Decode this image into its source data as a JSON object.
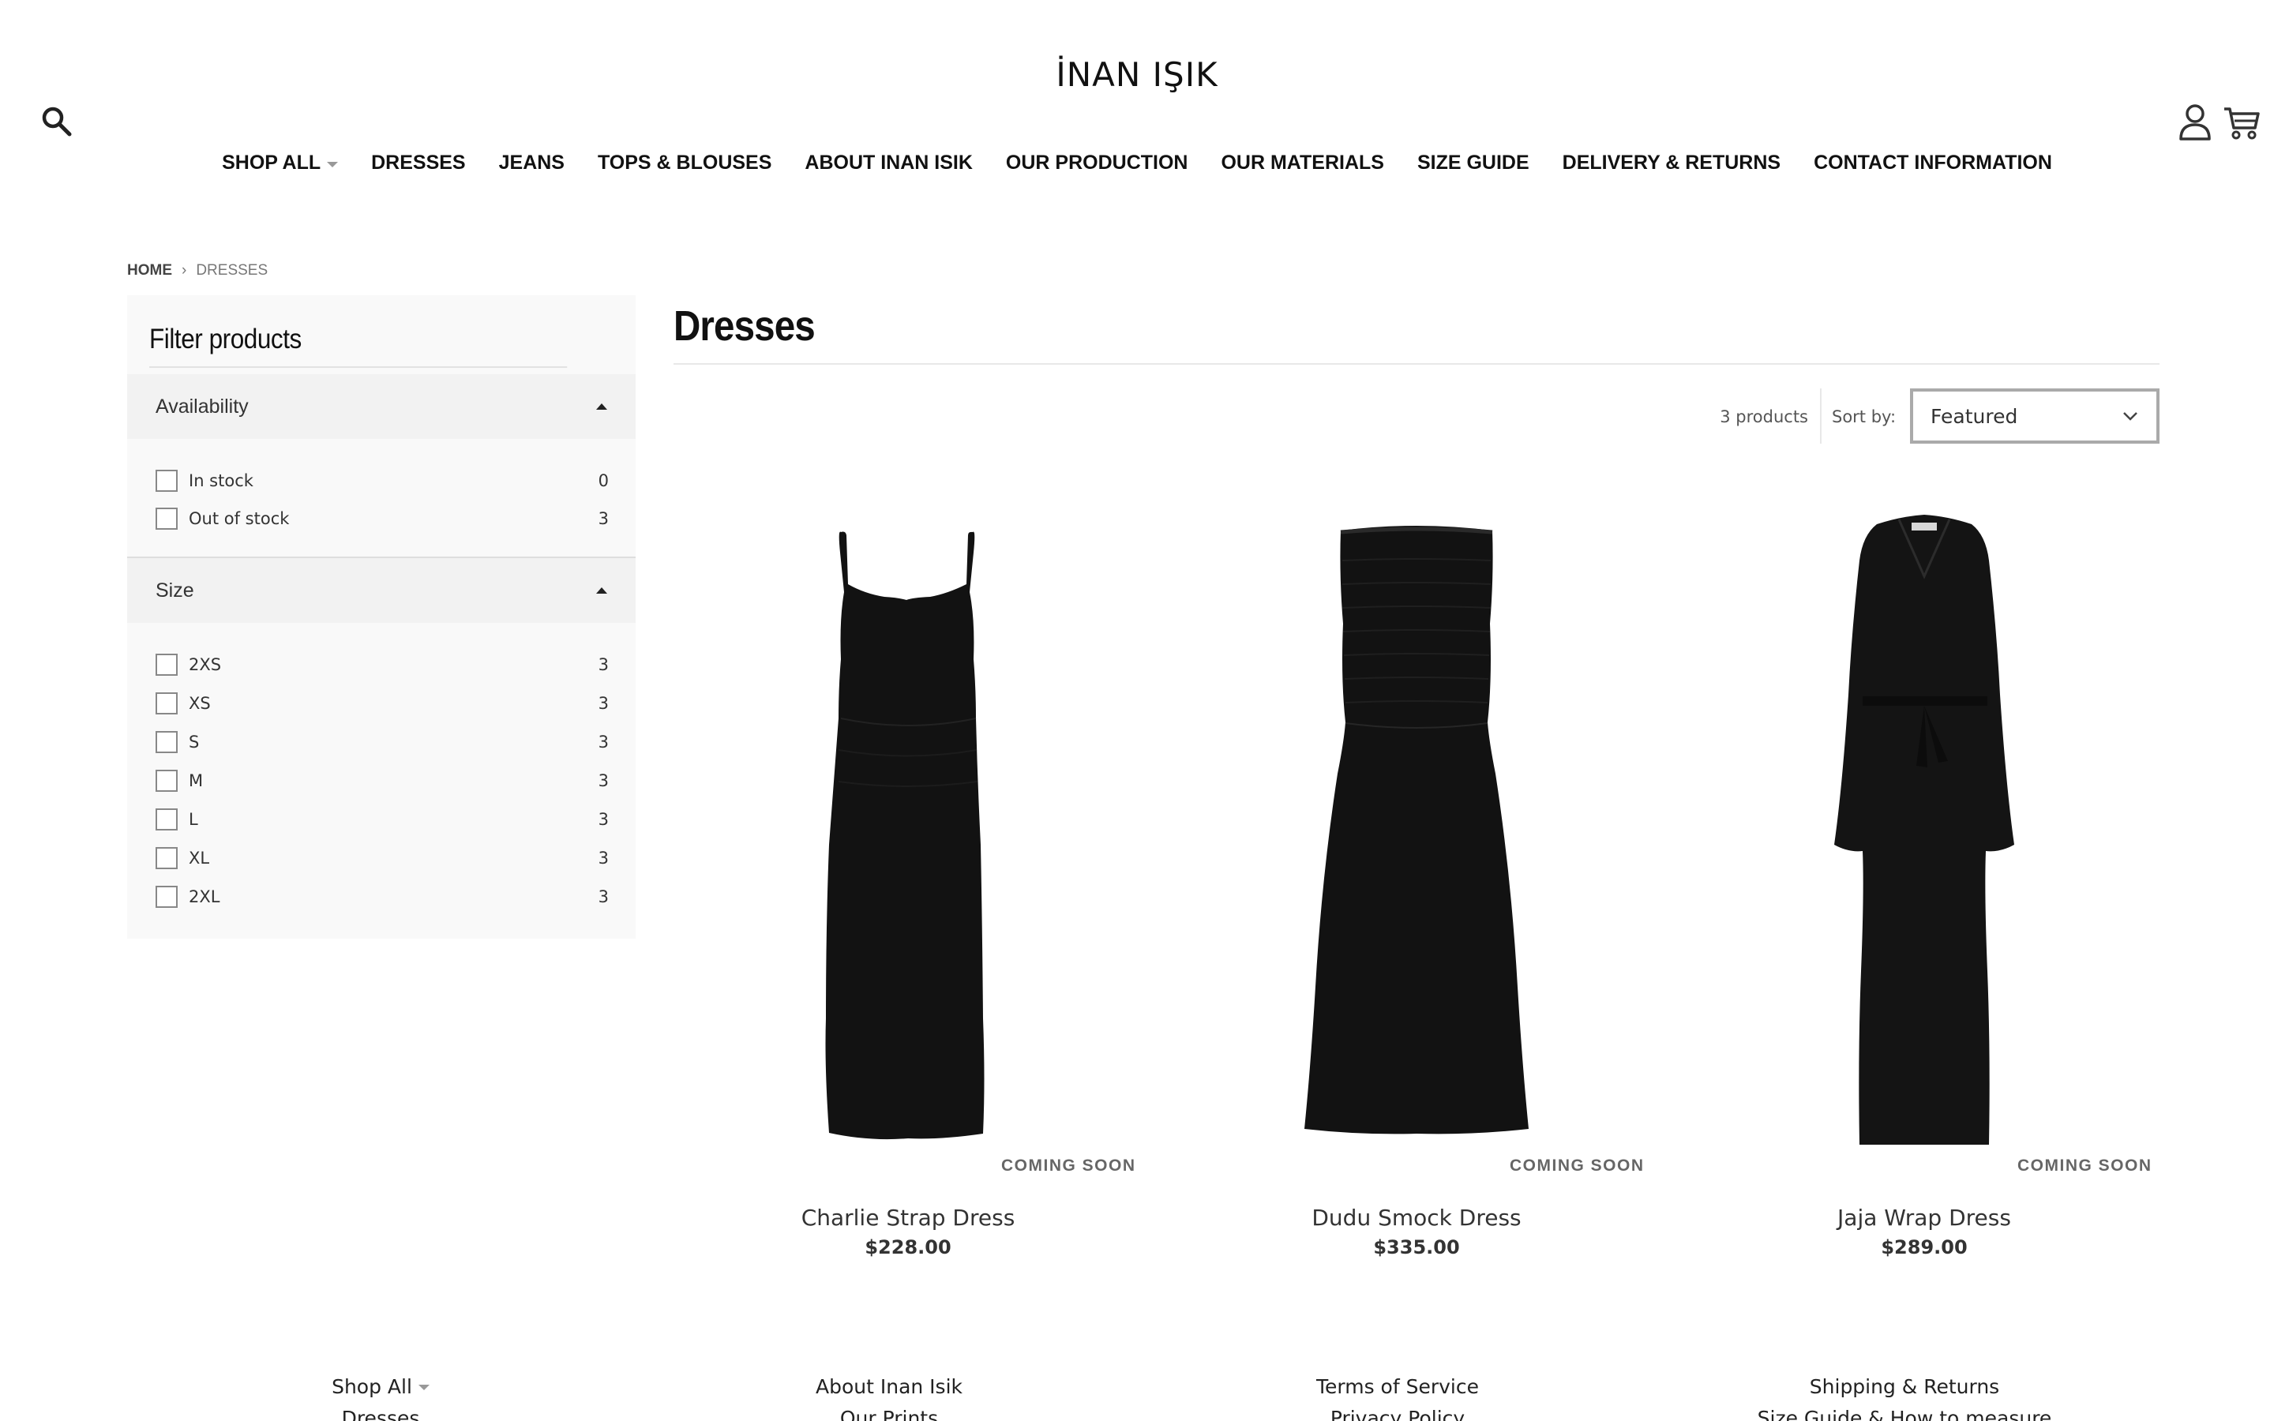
{
  "header": {
    "brand": "İNAN IŞIK",
    "icons": {
      "search": "search-icon",
      "account": "user-icon",
      "cart": "cart-icon"
    }
  },
  "nav": {
    "items": [
      {
        "label": "SHOP ALL",
        "has_dropdown": true
      },
      {
        "label": "DRESSES"
      },
      {
        "label": "JEANS"
      },
      {
        "label": "TOPS & BLOUSES"
      },
      {
        "label": "ABOUT INAN ISIK"
      },
      {
        "label": "OUR PRODUCTION"
      },
      {
        "label": "OUR MATERIALS"
      },
      {
        "label": "SIZE GUIDE"
      },
      {
        "label": "DELIVERY & RETURNS"
      },
      {
        "label": "CONTACT INFORMATION"
      }
    ]
  },
  "breadcrumb": {
    "home": "HOME",
    "separator": "›",
    "current": "DRESSES"
  },
  "sidebar": {
    "title": "Filter products",
    "availability": {
      "label": "Availability",
      "options": [
        {
          "label": "In stock",
          "count": "0"
        },
        {
          "label": "Out of stock",
          "count": "3"
        }
      ]
    },
    "size": {
      "label": "Size",
      "options": [
        {
          "label": "2XS",
          "count": "3"
        },
        {
          "label": "XS",
          "count": "3"
        },
        {
          "label": "S",
          "count": "3"
        },
        {
          "label": "M",
          "count": "3"
        },
        {
          "label": "L",
          "count": "3"
        },
        {
          "label": "XL",
          "count": "3"
        },
        {
          "label": "2XL",
          "count": "3"
        }
      ]
    }
  },
  "main": {
    "title": "Dresses",
    "product_count": "3 products",
    "sort_label": "Sort by:",
    "sort_value": "Featured",
    "products": [
      {
        "name": "Charlie Strap Dress",
        "price": "$228.00",
        "badge": "COMING SOON"
      },
      {
        "name": "Dudu Smock Dress",
        "price": "$335.00",
        "badge": "COMING SOON"
      },
      {
        "name": "Jaja Wrap Dress",
        "price": "$289.00",
        "badge": "COMING SOON"
      }
    ]
  },
  "footer": {
    "columns": [
      [
        "Shop All",
        "Dresses"
      ],
      [
        "About Inan Isik",
        "Our Prints"
      ],
      [
        "Terms of Service",
        "Privacy Policy"
      ],
      [
        "Shipping & Returns",
        "Size Guide & How to measure"
      ]
    ]
  },
  "colors": {
    "text": "#111111",
    "muted": "#777777",
    "sidebar_bg": "#f9f9f9",
    "product": "#111111"
  }
}
